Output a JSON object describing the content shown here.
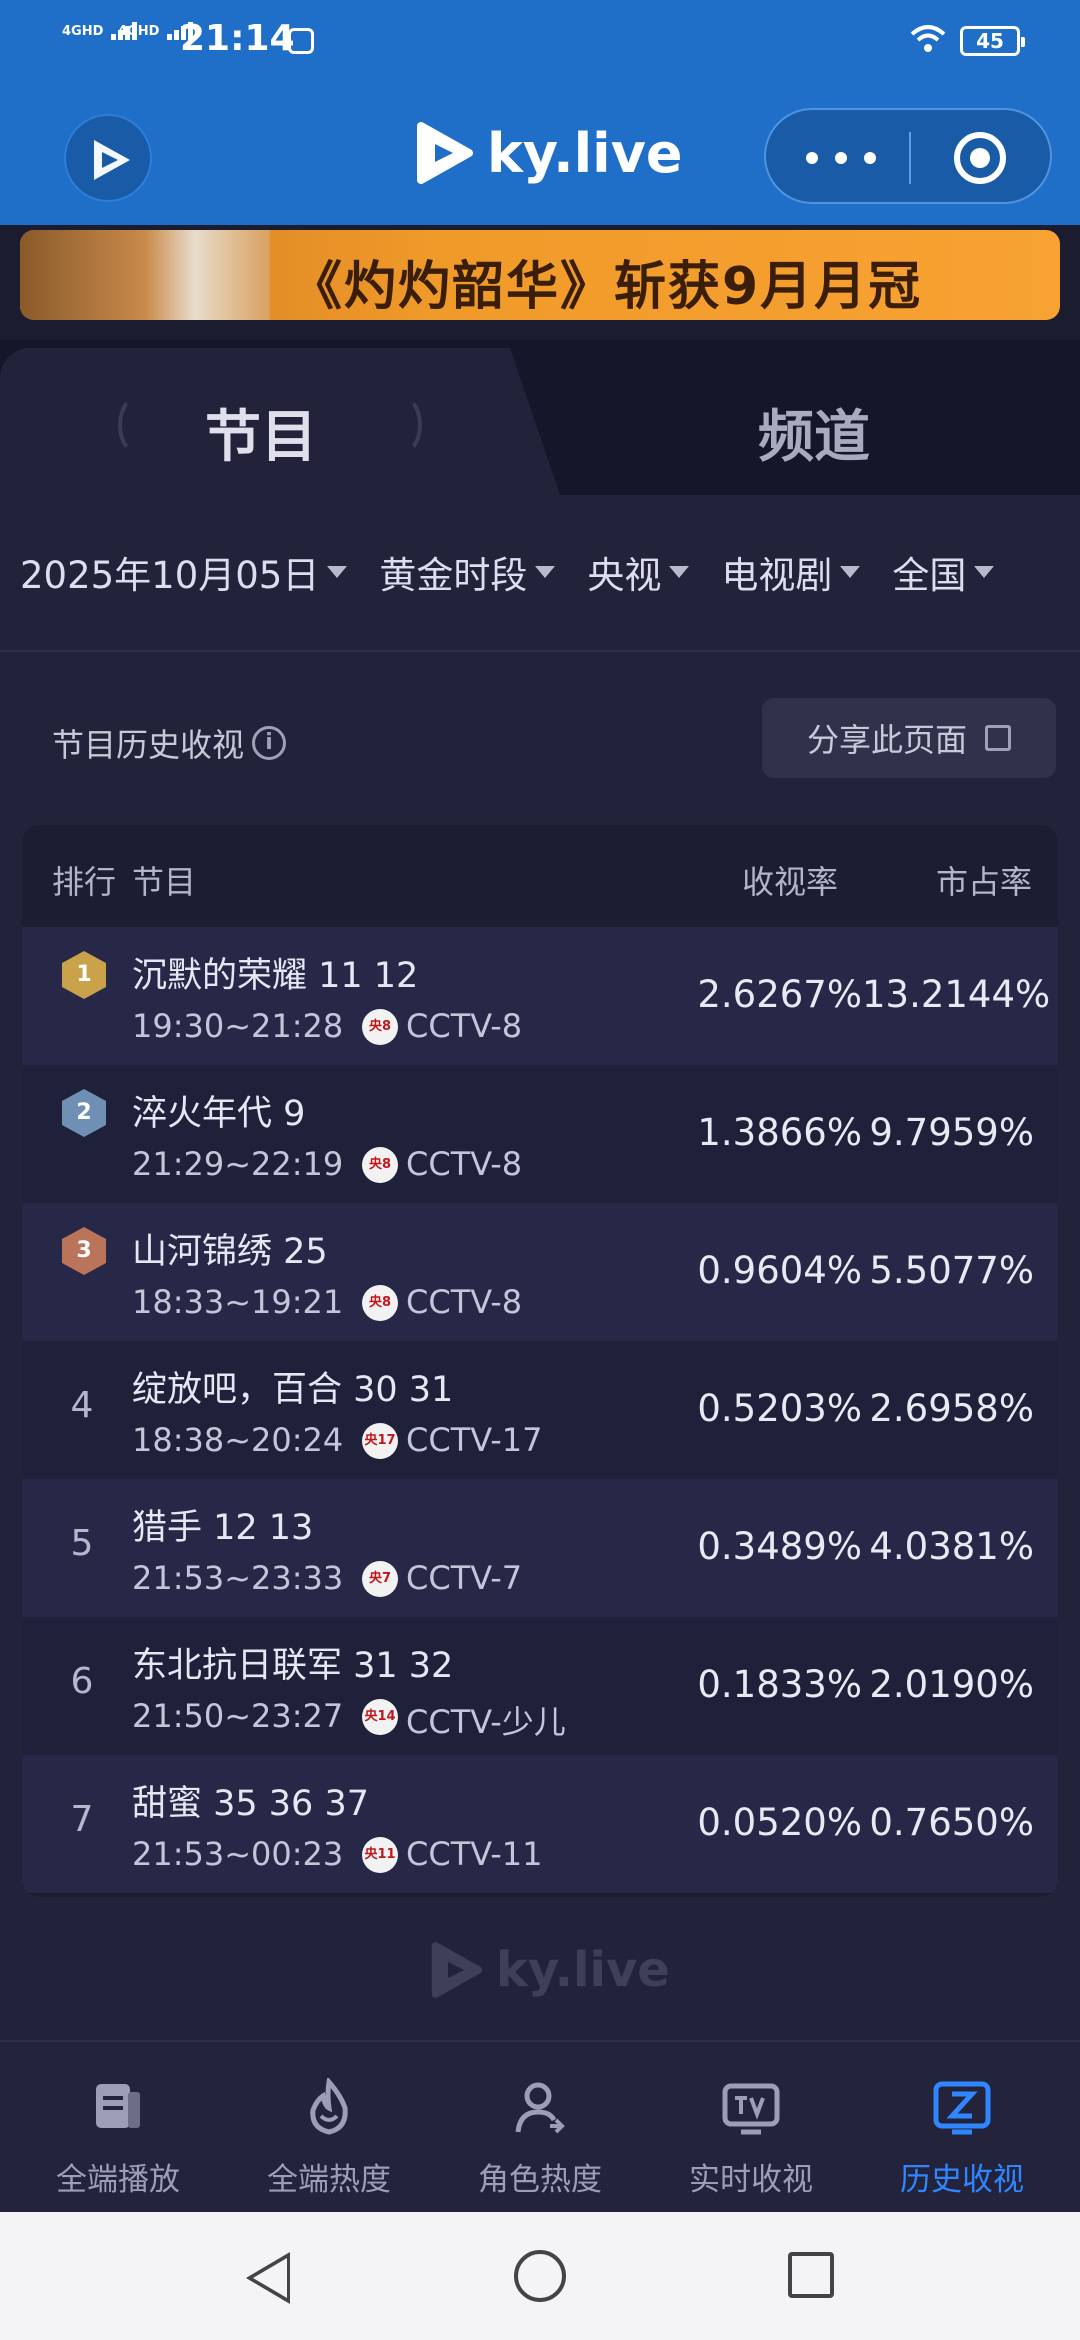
{
  "status_bar": {
    "network1": "4GHD",
    "network2": "4GHD",
    "time": "21:14",
    "battery": "45"
  },
  "header": {
    "brand": "ky.live"
  },
  "banner": {
    "text": "《灼灼韶华》斩获9月月冠"
  },
  "tabs": [
    {
      "label": "节目",
      "active": true
    },
    {
      "label": "频道",
      "active": false
    }
  ],
  "filters": [
    {
      "label": "2025年10月05日"
    },
    {
      "label": "黄金时段"
    },
    {
      "label": "央视"
    },
    {
      "label": "电视剧"
    },
    {
      "label": "全国"
    }
  ],
  "section": {
    "title": "节目历史收视",
    "info_glyph": "i",
    "share_label": "分享此页面"
  },
  "table": {
    "headers": {
      "rank": "排行",
      "program": "节目",
      "rating": "收视率",
      "share": "市占率"
    },
    "rows": [
      {
        "rank": "1",
        "title": "沉默的荣耀 11 12",
        "time": "19:30~21:28",
        "channel_logo": "央8",
        "channel": "CCTV-8",
        "rating": "2.6267%",
        "share": "13.2144%"
      },
      {
        "rank": "2",
        "title": "淬火年代 9",
        "time": "21:29~22:19",
        "channel_logo": "央8",
        "channel": "CCTV-8",
        "rating": "1.3866%",
        "share": "9.7959%"
      },
      {
        "rank": "3",
        "title": "山河锦绣 25",
        "time": "18:33~19:21",
        "channel_logo": "央8",
        "channel": "CCTV-8",
        "rating": "0.9604%",
        "share": "5.5077%"
      },
      {
        "rank": "4",
        "title": "绽放吧，百合 30 31",
        "time": "18:38~20:24",
        "channel_logo": "央17",
        "channel": "CCTV-17",
        "rating": "0.5203%",
        "share": "2.6958%"
      },
      {
        "rank": "5",
        "title": "猎手 12 13",
        "time": "21:53~23:33",
        "channel_logo": "央7",
        "channel": "CCTV-7",
        "rating": "0.3489%",
        "share": "4.0381%"
      },
      {
        "rank": "6",
        "title": "东北抗日联军 31 32",
        "time": "21:50~23:27",
        "channel_logo": "央14",
        "channel": "CCTV-少儿",
        "rating": "0.1833%",
        "share": "2.0190%"
      },
      {
        "rank": "7",
        "title": "甜蜜 35 36 37",
        "time": "21:53~00:23",
        "channel_logo": "央11",
        "channel": "CCTV-11",
        "rating": "0.0520%",
        "share": "0.7650%"
      }
    ]
  },
  "footer_brand": "ky.live",
  "bottom_nav": [
    {
      "label": "全端播放",
      "icon": "book-icon",
      "active": false
    },
    {
      "label": "全端热度",
      "icon": "flame-icon",
      "active": false
    },
    {
      "label": "角色热度",
      "icon": "person-icon",
      "active": false
    },
    {
      "label": "实时收视",
      "icon": "tv-icon",
      "active": false
    },
    {
      "label": "历史收视",
      "icon": "history-icon",
      "active": true
    }
  ],
  "colors": {
    "header_blue": "#1f6fc9",
    "background": "#22233a",
    "accent": "#2f86ff",
    "gold": "#c9a24a",
    "silver": "#6f8fb5",
    "bronze": "#b9745a"
  }
}
